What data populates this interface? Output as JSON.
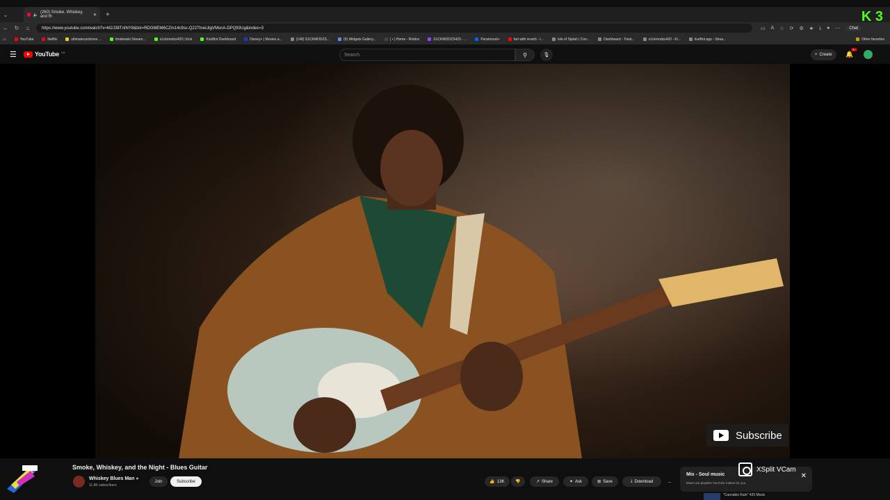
{
  "browser": {
    "tab_title": "(260) Smoke, Whiskey, and th",
    "new_tab": "+",
    "url": "https://www.youtube.com/watch?v=M2J38TnINY8&list=RDGMEM6CZm14c9sc-Q22TIneL8gVMsnA-DPQ93Ug&index=3",
    "chat_label": "Chat",
    "corner_badge": "K 3",
    "bookmarks": [
      "YouTube",
      "Netflix",
      "ultimatecardzone ...",
      "timdewski Stream...",
      "s1ckmodzs420 | Kick",
      "KickBot Dashboard",
      "Disney+ | Movies a...",
      "(148) S1CKMODZS...",
      "(6) Widgets Gallery...",
      "( • ) Home - Roblox",
      "S1CKMODZS420 - ...",
      "Paramount+",
      "fart with reverb - I...",
      "Isle of Siptah | Con...",
      "Dashboard - Treat...",
      "s1ckmodzs420 - Ki...",
      "liveBot.app - Strea..."
    ],
    "other_favorites": "Other favorites"
  },
  "youtube": {
    "logo_text": "YouTube",
    "country_code": "CA",
    "search_placeholder": "Search",
    "create_label": "Create",
    "notif_count": "9+"
  },
  "video": {
    "title": "Smoke, Whiskey, and the Night - Blues Guitar",
    "subscribe_watermark": "Subscribe"
  },
  "channel": {
    "name": "Whiskey Blues Man",
    "subscribers": "11.8K subscribers",
    "join_label": "Join",
    "subscribe_label": "Subscribe"
  },
  "actions": {
    "likes": "13K",
    "share": "Share",
    "ask": "Ask",
    "save": "Save",
    "download": "Download",
    "more": "..."
  },
  "mix": {
    "title": "Mix - Soul music",
    "subtitle": "Mixes are playlists YouTube makes for you",
    "close": "✕",
    "next_video": "\"Cannabis Rain\" 420 Music"
  },
  "overlay": {
    "xsplit_label": "XSplit VCam"
  }
}
